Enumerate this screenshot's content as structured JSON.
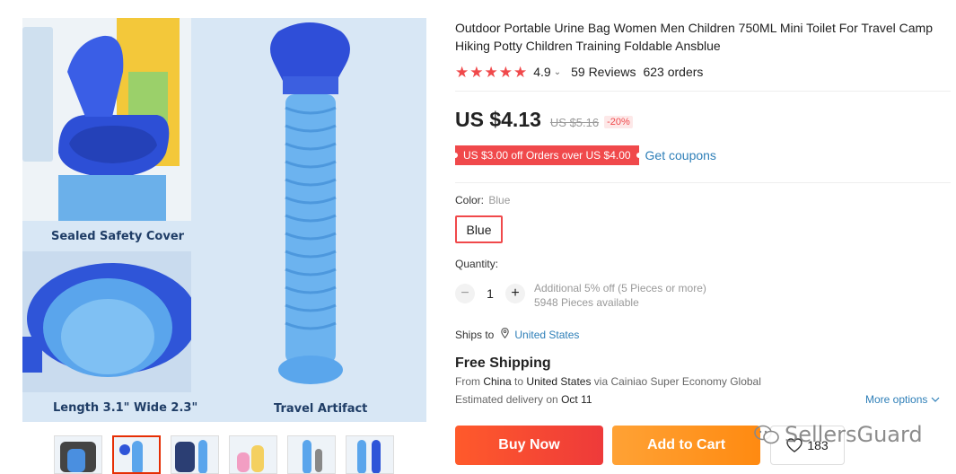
{
  "gallery": {
    "captions": [
      "Sealed Safety Cover",
      "Length 3.1\" Wide 2.3\"",
      "Travel Artifact"
    ],
    "thumbnail_count": 6,
    "active_thumbnail": 2
  },
  "product": {
    "title": "Outdoor Portable Urine Bag Women Men Children 750ML Mini Toilet For Travel Camp Hiking Potty Children Training Foldable Ansblue",
    "rating": "4.9",
    "reviews": "59 Reviews",
    "orders": "623 orders",
    "price": "US $4.13",
    "old_price": "US $5.16",
    "discount": "-20%",
    "coupon": "US $3.00 off Orders over US $4.00",
    "get_coupons": "Get coupons",
    "color_label": "Color:",
    "color_selected": "Blue",
    "color_option": "Blue",
    "quantity_label": "Quantity:",
    "quantity_minus": "−",
    "quantity_value": "1",
    "quantity_plus": "+",
    "quantity_discount": "Additional 5% off (5 Pieces or more)",
    "quantity_available": "5948 Pieces available",
    "ships_to_label": "Ships to",
    "ships_to_country": "United States",
    "free_shipping": "Free Shipping",
    "from_prefix": "From",
    "from_country": "China",
    "to_word": "to",
    "to_country": "United States",
    "via_text": "via Cainiao Super Economy Global",
    "est_prefix": "Estimated delivery on",
    "est_date": "Oct 11",
    "more_options": "More options",
    "buy_now": "Buy Now",
    "add_to_cart": "Add to Cart",
    "wishlist_count": "183"
  },
  "watermark": "SellersGuard",
  "colors": {
    "accent_red": "#f0494b",
    "link_blue": "#2e7fb8",
    "buy_now": "#ff4f2a",
    "add_to_cart": "#ff9a1f",
    "product_blue": "#4a9fe0"
  }
}
